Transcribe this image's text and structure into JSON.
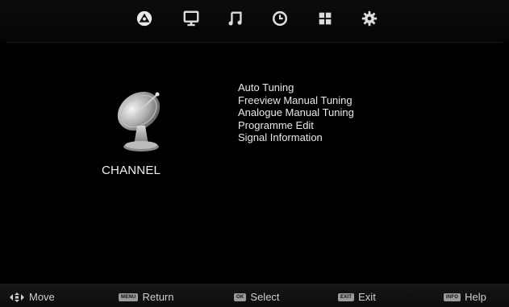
{
  "top_tabs": [
    {
      "icon": "satellite-dish-icon",
      "active": true
    },
    {
      "icon": "monitor-icon"
    },
    {
      "icon": "music-note-icon"
    },
    {
      "icon": "clock-icon"
    },
    {
      "icon": "grid-icon"
    },
    {
      "icon": "gear-icon"
    }
  ],
  "category": {
    "label": "CHANNEL",
    "icon": "satellite-dish-icon"
  },
  "menu": {
    "items": [
      "Auto Tuning",
      "Freeview Manual Tuning",
      "Analogue Manual Tuning",
      "Programme Edit",
      "Signal Information"
    ]
  },
  "footer": {
    "move": {
      "label": "Move",
      "icon": "arrows-icon"
    },
    "return": {
      "key": "MENU",
      "label": "Return"
    },
    "select": {
      "key": "OK",
      "label": "Select"
    },
    "exit": {
      "key": "EXIT",
      "label": "Exit"
    },
    "help": {
      "key": "INFO",
      "label": "Help"
    }
  },
  "colors": {
    "background": "#000000",
    "text": "#e8e8e8",
    "key_badge": "#9a9a9a"
  }
}
